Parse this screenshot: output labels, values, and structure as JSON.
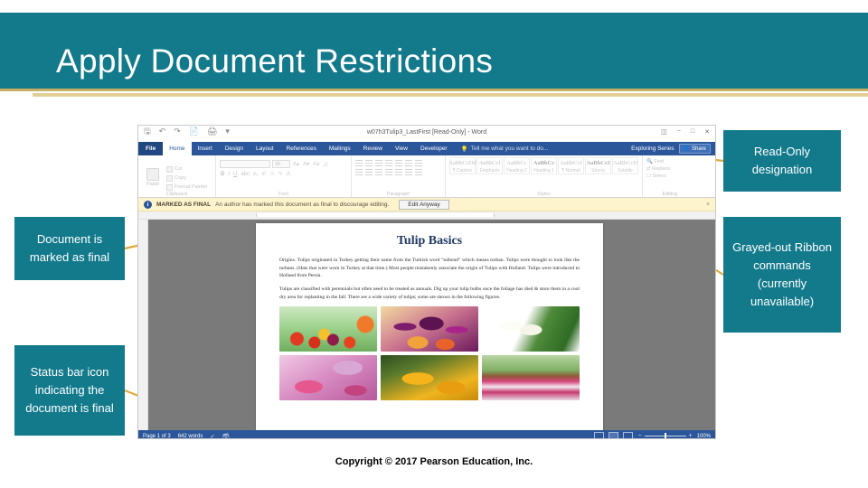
{
  "slide": {
    "title": "Apply Document Restrictions",
    "header_bg": "#137a8c",
    "accent_rule": "#c9ad63",
    "copyright": "Copyright © 2017 Pearson Education, Inc."
  },
  "callouts": {
    "doc_final": "Document is marked as final",
    "status_bar": "Status bar icon indicating the document is final",
    "read_only": "Read-Only designation",
    "grayed_out": "Grayed-out Ribbon commands (currently unavailable)"
  },
  "word": {
    "document_title": "w07h3Tulip3_LastFirst [Read-Only] - Word",
    "quick_access": [
      "save-icon",
      "undo-icon",
      "redo-icon",
      "new-icon",
      "print-preview-icon",
      "customize-qat-icon"
    ],
    "window_controls": [
      "ribbon-display-options-icon",
      "minimize-icon",
      "restore-icon",
      "close-icon"
    ],
    "account_label": "Exploring Series",
    "share_label": "Share",
    "tabs": [
      {
        "label": "File",
        "active": false,
        "is_file": true
      },
      {
        "label": "Home",
        "active": true,
        "is_file": false
      },
      {
        "label": "Insert",
        "active": false,
        "is_file": false
      },
      {
        "label": "Design",
        "active": false,
        "is_file": false
      },
      {
        "label": "Layout",
        "active": false,
        "is_file": false
      },
      {
        "label": "References",
        "active": false,
        "is_file": false
      },
      {
        "label": "Mailings",
        "active": false,
        "is_file": false
      },
      {
        "label": "Review",
        "active": false,
        "is_file": false
      },
      {
        "label": "View",
        "active": false,
        "is_file": false
      },
      {
        "label": "Developer",
        "active": false,
        "is_file": false
      }
    ],
    "tell_me": "Tell me what you want to do...",
    "ribbon": {
      "clipboard": {
        "group_label": "Clipboard",
        "paste_label": "Paste",
        "commands": [
          "Cut",
          "Copy",
          "Format Painter"
        ]
      },
      "font": {
        "group_label": "Font",
        "font_name": "",
        "font_size": "26"
      },
      "paragraph": {
        "group_label": "Paragraph"
      },
      "styles": {
        "group_label": "Styles",
        "items": [
          {
            "sample": "AaBbCcDd",
            "name": "¶ Caption"
          },
          {
            "sample": "AaBbCcI",
            "name": "Emphasis"
          },
          {
            "sample": "AaBbCc",
            "name": "Heading 2"
          },
          {
            "sample": "AaBbCc",
            "name": "Heading 1"
          },
          {
            "sample": "AaBbCcI",
            "name": "¶ Normal"
          },
          {
            "sample": "AaBbCcI",
            "name": "Strong"
          },
          {
            "sample": "AaBbCcD",
            "name": "Subtitle"
          }
        ]
      },
      "editing": {
        "group_label": "Editing",
        "commands": [
          "Find",
          "Replace",
          "Select"
        ]
      }
    },
    "message_bar": {
      "icon": "info-icon",
      "title": "MARKED AS FINAL",
      "text": "An author has marked this document as final to discourage editing.",
      "button": "Edit Anyway",
      "close": "×"
    },
    "document": {
      "heading": "Tulip Basics",
      "paragraphs": [
        "Origins. Tulips originated in Turkey getting their name from the Turkish word \"tulbend\" which means turban. Tulips were thought to look like the turbans. (Hats that were worn in Turkey at that time.) Most people mistakenly associate the origin of Tulips with Holland. Tulips were introduced to Holland from Persia.",
        "Tulips are classified with perennials but often need to be treated as annuals. Dig up your tulip bulbs once the foliage has died & store them in a cool dry area for replanting in the fall. There are a wide variety of tulips; some are shown in the following figures."
      ],
      "images": [
        "red-and-yellow-tulip-field",
        "purple-and-magenta-tulips",
        "white-tulip-bouquet",
        "pink-and-lavender-tulips",
        "yellow-tulips-closeup",
        "tulip-lined-forest-path"
      ]
    },
    "status_bar": {
      "page": "Page 1 of 3",
      "words": "642 words",
      "icons": [
        "proofing-icon",
        "marked-as-final-icon"
      ],
      "views": [
        "read-mode-view",
        "print-layout-view",
        "web-layout-view"
      ],
      "zoom": "100%"
    }
  }
}
